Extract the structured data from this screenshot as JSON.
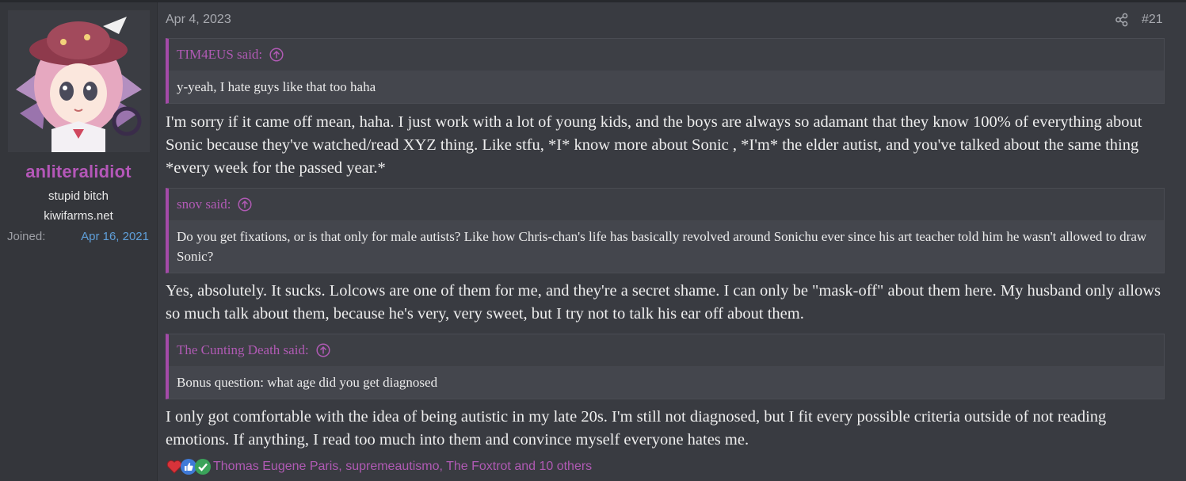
{
  "user": {
    "name": "anliteralidiot",
    "title": "stupid bitch",
    "banner": "kiwifarms.net",
    "joined_label": "Joined:",
    "joined_value": "Apr 16, 2021"
  },
  "post": {
    "date": "Apr 4, 2023",
    "number": "#21",
    "blocks": {
      "q1_author": "TIM4EUS said:",
      "q1_text": "y-yeah, I hate guys like that too haha",
      "p1": "I'm sorry if it came off mean, haha. I just work with a lot of young kids, and the boys are always so adamant that they know 100% of everything about Sonic because they've watched/read XYZ thing. Like stfu, *I* know more about Sonic , *I'm* the elder autist, and you've talked about the same thing *every week for the passed year.*",
      "q2_author": "snov said:",
      "q2_text": "Do you get fixations, or is that only for male autists? Like how Chris-chan's life has basically revolved around Sonichu ever since his art teacher told him he wasn't allowed to draw Sonic?",
      "p2": "Yes, absolutely. It sucks. Lolcows are one of them for me, and they're a secret shame. I can only be \"mask-off\" about them here. My husband only allows so much talk about them, because he's very, very sweet, but I try not to talk his ear off about them.",
      "q3_author": "The Cunting Death said:",
      "q3_text": "Bonus question: what age did you get diagnosed",
      "p3": "I only got comfortable with the idea of being autistic in my late 20s. I'm still not diagnosed, but I fit every possible criteria outside of not reading emotions. If anything, I read too much into them and convince myself everyone hates me."
    }
  },
  "reactions": {
    "icons": [
      "heart-icon",
      "thumbs-up-icon",
      "check-icon"
    ],
    "users_text": "Thomas Eugene Paris, supremeautismo, The Foxtrot and 10 others"
  },
  "colors": {
    "accent": "#b457b8",
    "quote_border": "#a44aa8",
    "joined_value": "#5f9fd9",
    "background": "#393b41"
  }
}
